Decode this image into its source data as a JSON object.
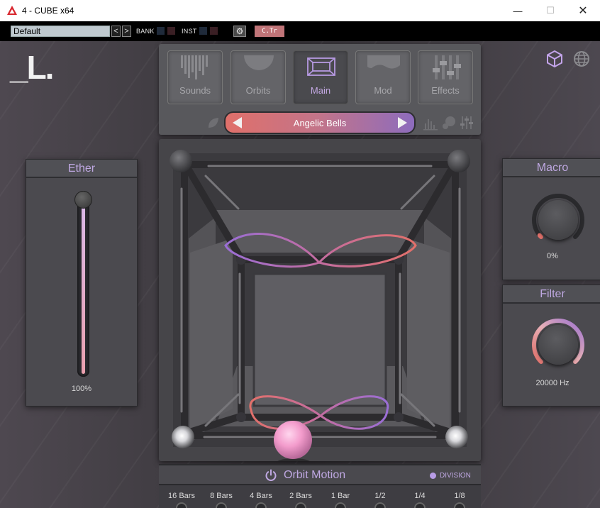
{
  "window": {
    "title": "4 - CUBE x64",
    "minimize": "—",
    "maximize": "☐",
    "close": "✕"
  },
  "host": {
    "preset": "Default",
    "prev": "<",
    "next": ">",
    "bank_label": "BANK",
    "inst_label": "INST",
    "gear": "⚙",
    "ctr_label": "C.Tr"
  },
  "logo": "_L.",
  "nav": {
    "tabs": [
      {
        "label": "Sounds",
        "icon": "sounds-icon"
      },
      {
        "label": "Orbits",
        "icon": "orbits-icon"
      },
      {
        "label": "Main",
        "icon": "main-icon"
      },
      {
        "label": "Mod",
        "icon": "mod-icon"
      },
      {
        "label": "Effects",
        "icon": "effects-icon"
      }
    ],
    "active_tab": "Main",
    "preset_name": "Angelic Bells"
  },
  "ether": {
    "title": "Ether",
    "value": "100%",
    "level": 1.0
  },
  "macro": {
    "title": "Macro",
    "value": "0%",
    "level": 0.0
  },
  "filter": {
    "title": "Filter",
    "value": "20000 Hz",
    "level": 1.0
  },
  "orbit_motion": {
    "title": "Orbit Motion",
    "division_label": "DIVISION",
    "rates": [
      "16 Bars",
      "8 Bars",
      "4 Bars",
      "2 Bars",
      "1 Bar",
      "1/2",
      "1/4",
      "1/8"
    ]
  },
  "colors": {
    "accent_purple": "#bfa8e2",
    "accent_coral": "#e0706a",
    "accent_violet": "#8d6cbd",
    "orb_pink": "#f0a0d0"
  }
}
